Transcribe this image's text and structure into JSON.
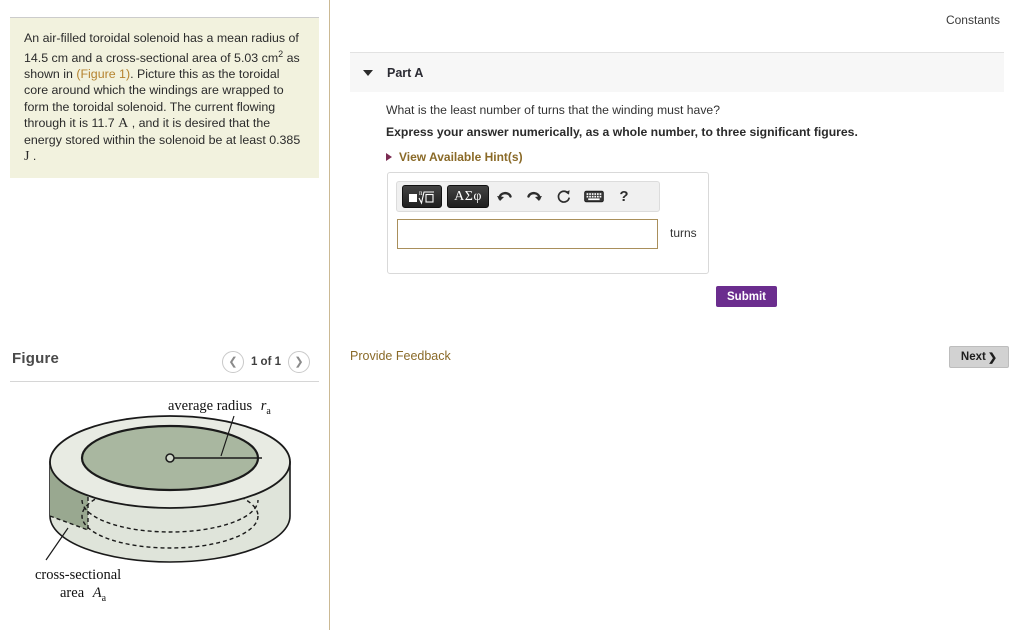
{
  "problem": {
    "text_before_link": "An air-filled toroidal solenoid has a mean radius of 14.5 cm and a cross-sectional area of 5.03 cm",
    "area_exponent": "2",
    "text_after_exponent": " as shown in ",
    "figure_link": "(Figure 1)",
    "text_middle": ". Picture this as the toroidal core around which the windings are wrapped to form the toroidal solenoid. The current flowing through it is 11.7 ",
    "current_unit": "A",
    "text_after_current": " , and it is desired that the energy stored within the solenoid be at least 0.385 ",
    "energy_unit": "J",
    "text_end": " ."
  },
  "figure_panel": {
    "title": "Figure",
    "prev_icon": "chevron-left-icon",
    "counter": "1 of 1",
    "next_icon": "chevron-right-icon",
    "diagram": {
      "label_radius": "average radius",
      "label_radius_symbol": "r",
      "label_radius_subscript": "a",
      "label_area_line1": "cross-sectional",
      "label_area_line2": "area",
      "label_area_symbol": "A",
      "label_area_subscript": "a",
      "colors": {
        "body": "#dfe4da",
        "body_dark": "#99a890",
        "top_ring": "#e8ebe3",
        "inner_disk": "#a9b7a0",
        "outline": "#1a1a1a"
      }
    }
  },
  "right": {
    "constants_label": "Constants",
    "part": {
      "collapse_icon": "triangle-down-icon",
      "title": "Part A"
    },
    "question_prompt": "What is the least number of turns that the winding must have?",
    "question_instruction": "Express your answer numerically, as a whole number, to three significant figures.",
    "hints": {
      "triangle_icon": "triangle-right-icon",
      "label": "View Available Hint(s)"
    },
    "answer": {
      "toolbar": {
        "template_button": "template-math-icon",
        "template_glyph_square": "■",
        "template_glyph_root": "√",
        "template_glyph_box": "□",
        "greek_button": "ΑΣφ",
        "undo_icon": "undo-arrow-icon",
        "undo_glyph": "↰",
        "redo_icon": "redo-arrow-icon",
        "redo_glyph": "↱",
        "reset_icon": "reset-circular-arrow-icon",
        "reset_glyph": "↻",
        "keyboard_icon": "keyboard-icon",
        "help_icon": "help-question-icon",
        "help_glyph": "?"
      },
      "input_value": "",
      "input_placeholder": "",
      "units_label": "turns"
    },
    "submit_label": "Submit",
    "provide_feedback_label": "Provide Feedback",
    "next_label": "Next",
    "next_chevron": "❯"
  },
  "theme": {
    "problem_bg": "#f2f2de",
    "divider": "#cbb994",
    "submit_bg": "#6b2d8e",
    "link_gold": "#8a6a28",
    "figure_link": "#b5832f",
    "input_border": "#a98f5b"
  }
}
